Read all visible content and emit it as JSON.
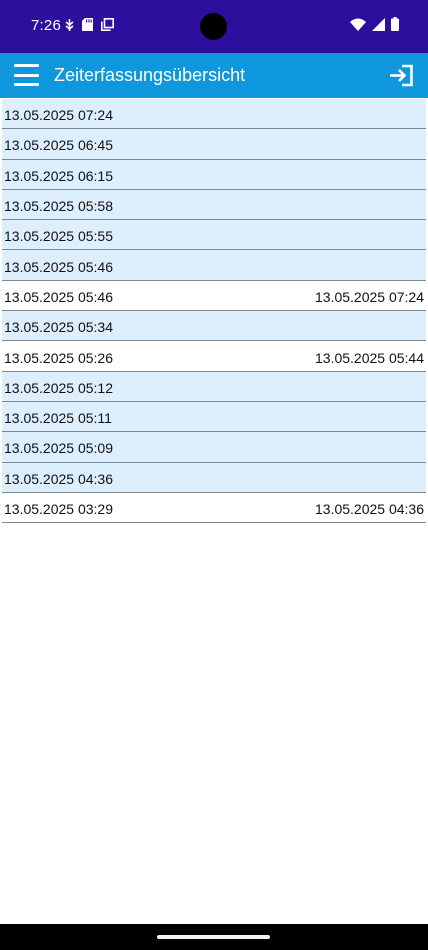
{
  "status_bar": {
    "time": "7:26",
    "background": "#2d0f9e",
    "icons_left": [
      "usb-debug-icon",
      "sd-card-icon",
      "copy-icon"
    ],
    "icons_right": [
      "wifi-icon",
      "signal-icon",
      "battery-icon"
    ]
  },
  "app_bar": {
    "title": "Zeiterfassungsübersicht",
    "background": "#0e97dd",
    "menu_icon": "hamburger-menu-icon",
    "action_icon": "login-icon"
  },
  "entries": [
    {
      "start": "13.05.2025 07:24",
      "end": "",
      "status": "open"
    },
    {
      "start": "13.05.2025 06:45",
      "end": "",
      "status": "open"
    },
    {
      "start": "13.05.2025 06:15",
      "end": "",
      "status": "open"
    },
    {
      "start": "13.05.2025 05:58",
      "end": "",
      "status": "open"
    },
    {
      "start": "13.05.2025 05:55",
      "end": "",
      "status": "open"
    },
    {
      "start": "13.05.2025 05:46",
      "end": "",
      "status": "open"
    },
    {
      "start": "13.05.2025 05:46",
      "end": "13.05.2025 07:24",
      "status": "closed"
    },
    {
      "start": "13.05.2025 05:34",
      "end": "",
      "status": "open"
    },
    {
      "start": "13.05.2025 05:26",
      "end": "13.05.2025 05:44",
      "status": "closed"
    },
    {
      "start": "13.05.2025 05:12",
      "end": "",
      "status": "open"
    },
    {
      "start": "13.05.2025 05:11",
      "end": "",
      "status": "open"
    },
    {
      "start": "13.05.2025 05:09",
      "end": "",
      "status": "open"
    },
    {
      "start": "13.05.2025 04:36",
      "end": "",
      "status": "open"
    },
    {
      "start": "13.05.2025 03:29",
      "end": "13.05.2025 04:36",
      "status": "closed"
    }
  ],
  "colors": {
    "open_row": "#ddeefd",
    "closed_row": "#ffffff",
    "divider": "#7c8a96"
  }
}
